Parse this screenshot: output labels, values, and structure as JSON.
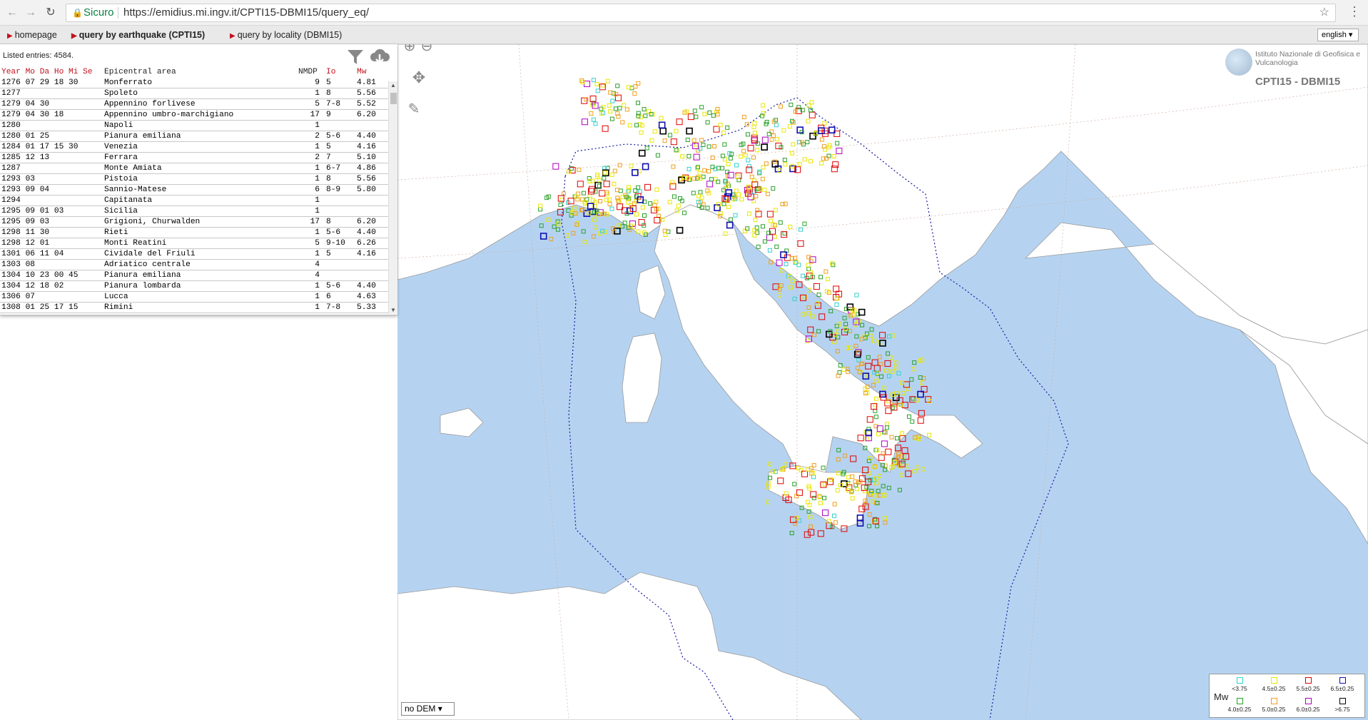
{
  "browser": {
    "secure_label": "Sicuro",
    "url": "https://emidius.mi.ingv.it/CPTI15-DBMI15/query_eq/"
  },
  "sitebar": {
    "links": [
      "homepage",
      "query by earthquake (CPTI15)",
      "query by locality (DBMI15)"
    ],
    "language": "english"
  },
  "list": {
    "listed": "Listed entries: 4584.",
    "header": {
      "date": "Year Mo Da Ho Mi Se",
      "area": "Epicentral area",
      "nmdp": "NMDP",
      "io": "Io",
      "mw": "Mw"
    },
    "rows": [
      {
        "date": "1276 07 29 18 30",
        "area": "Monferrato",
        "nmdp": "9",
        "io": "5",
        "mw": "4.81"
      },
      {
        "date": "1277",
        "area": "Spoleto",
        "nmdp": "1",
        "io": "8",
        "mw": "5.56"
      },
      {
        "date": "1279 04 30",
        "area": "Appennino forlivese",
        "nmdp": "5",
        "io": "7-8",
        "mw": "5.52"
      },
      {
        "date": "1279 04 30 18",
        "area": "Appennino umbro-marchigiano",
        "nmdp": "17",
        "io": "9",
        "mw": "6.20"
      },
      {
        "date": "1280",
        "area": "Napoli",
        "nmdp": "1",
        "io": "",
        "mw": ""
      },
      {
        "date": "1280 01 25",
        "area": "Pianura emiliana",
        "nmdp": "2",
        "io": "5-6",
        "mw": "4.40"
      },
      {
        "date": "1284 01 17 15 30",
        "area": "Venezia",
        "nmdp": "1",
        "io": "5",
        "mw": "4.16"
      },
      {
        "date": "1285 12 13",
        "area": "Ferrara",
        "nmdp": "2",
        "io": "7",
        "mw": "5.10"
      },
      {
        "date": "1287",
        "area": "Monte Amiata",
        "nmdp": "1",
        "io": "6-7",
        "mw": "4.86"
      },
      {
        "date": "1293 03",
        "area": "Pistoia",
        "nmdp": "1",
        "io": "8",
        "mw": "5.56"
      },
      {
        "date": "1293 09 04",
        "area": "Sannio-Matese",
        "nmdp": "6",
        "io": "8-9",
        "mw": "5.80"
      },
      {
        "date": "1294",
        "area": "Capitanata",
        "nmdp": "1",
        "io": "",
        "mw": ""
      },
      {
        "date": "1295 09 01 03",
        "area": "Sicilia",
        "nmdp": "1",
        "io": "",
        "mw": ""
      },
      {
        "date": "1295 09 03",
        "area": "Grigioni, Churwalden",
        "nmdp": "17",
        "io": "8",
        "mw": "6.20"
      },
      {
        "date": "1298 11 30",
        "area": "Rieti",
        "nmdp": "1",
        "io": "5-6",
        "mw": "4.40"
      },
      {
        "date": "1298 12 01",
        "area": "Monti Reatini",
        "nmdp": "5",
        "io": "9-10",
        "mw": "6.26"
      },
      {
        "date": "1301 06 11 04",
        "area": "Cividale del Friuli",
        "nmdp": "1",
        "io": "5",
        "mw": "4.16"
      },
      {
        "date": "1303 08",
        "area": "Adriatico centrale",
        "nmdp": "4",
        "io": "",
        "mw": ""
      },
      {
        "date": "1304 10 23 00 45",
        "area": "Pianura emiliana",
        "nmdp": "4",
        "io": "",
        "mw": ""
      },
      {
        "date": "1304 12 18 02",
        "area": "Pianura lombarda",
        "nmdp": "1",
        "io": "5-6",
        "mw": "4.40"
      },
      {
        "date": "1306 07",
        "area": "Lucca",
        "nmdp": "1",
        "io": "6",
        "mw": "4.63"
      },
      {
        "date": "1308 01 25 17 15",
        "area": "Rimini",
        "nmdp": "1",
        "io": "7-8",
        "mw": "5.33"
      }
    ]
  },
  "map": {
    "logo_org": "Istituto Nazionale di Geofisica e Vulcanologia",
    "logo_title": "CPTI15 - DBMI15",
    "dem_select": "no DEM",
    "legend": {
      "title": "Mw",
      "items": [
        {
          "label": "<3.75",
          "color": "#35d0d0"
        },
        {
          "label": "4.0±0.25",
          "color": "#2ca02c"
        },
        {
          "label": "4.5±0.25",
          "color": "#e8e800"
        },
        {
          "label": "5.0±0.25",
          "color": "#f0a020"
        },
        {
          "label": "5.5±0.25",
          "color": "#e00000"
        },
        {
          "label": "6.0±0.25",
          "color": "#b000c0"
        },
        {
          "label": "6.5±0.25",
          "color": "#1010b0"
        },
        {
          "label": ">6.75",
          "color": "#000000"
        }
      ]
    },
    "colors": {
      "sea": "#b5d3f1",
      "land": "#ffffff",
      "border": "#9a9a9a",
      "zone": "#1a1aa0"
    }
  }
}
